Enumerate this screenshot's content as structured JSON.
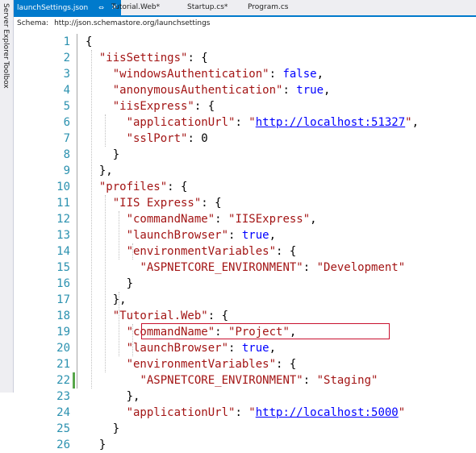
{
  "side_panel": {
    "server_explorer": "Server Explorer",
    "toolbox": "Toolbox"
  },
  "tabs": [
    {
      "label": "launchSettings.json",
      "active": true,
      "pinned": true
    },
    {
      "label": "Tutorial.Web*"
    },
    {
      "label": "Startup.cs*"
    },
    {
      "label": "Program.cs"
    }
  ],
  "schema_bar": {
    "label": "Schema:",
    "url": "http://json.schemastore.org/launchsettings"
  },
  "editor": {
    "lines": [
      {
        "n": "1",
        "tokens": [
          [
            "p",
            "{"
          ]
        ]
      },
      {
        "n": "2",
        "tokens": [
          [
            "s",
            "\"iisSettings\""
          ],
          [
            "p",
            ": {"
          ]
        ]
      },
      {
        "n": "3",
        "tokens": [
          [
            "s",
            "\"windowsAuthentication\""
          ],
          [
            "p",
            ": "
          ],
          [
            "n",
            "false"
          ],
          [
            "p",
            ","
          ]
        ]
      },
      {
        "n": "4",
        "tokens": [
          [
            "s",
            "\"anonymousAuthentication\""
          ],
          [
            "p",
            ": "
          ],
          [
            "n",
            "true"
          ],
          [
            "p",
            ","
          ]
        ]
      },
      {
        "n": "5",
        "tokens": [
          [
            "s",
            "\"iisExpress\""
          ],
          [
            "p",
            ": {"
          ]
        ]
      },
      {
        "n": "6",
        "tokens": [
          [
            "s",
            "\"applicationUrl\""
          ],
          [
            "p",
            ": "
          ],
          [
            "s",
            "\""
          ],
          [
            "u",
            "http://localhost:51327"
          ],
          [
            "s",
            "\""
          ],
          [
            "p",
            ","
          ]
        ]
      },
      {
        "n": "7",
        "tokens": [
          [
            "s",
            "\"sslPort\""
          ],
          [
            "p",
            ": 0"
          ]
        ]
      },
      {
        "n": "8",
        "tokens": [
          [
            "p",
            "}"
          ]
        ]
      },
      {
        "n": "9",
        "tokens": [
          [
            "p",
            "},"
          ]
        ]
      },
      {
        "n": "10",
        "tokens": [
          [
            "s",
            "\"profiles\""
          ],
          [
            "p",
            ": {"
          ]
        ]
      },
      {
        "n": "11",
        "tokens": [
          [
            "s",
            "\"IIS Express\""
          ],
          [
            "p",
            ": {"
          ]
        ]
      },
      {
        "n": "12",
        "tokens": [
          [
            "s",
            "\"commandName\""
          ],
          [
            "p",
            ": "
          ],
          [
            "s",
            "\"IISExpress\""
          ],
          [
            "p",
            ","
          ]
        ]
      },
      {
        "n": "13",
        "tokens": [
          [
            "s",
            "\"launchBrowser\""
          ],
          [
            "p",
            ": "
          ],
          [
            "n",
            "true"
          ],
          [
            "p",
            ","
          ]
        ]
      },
      {
        "n": "14",
        "tokens": [
          [
            "s",
            "\"environmentVariables\""
          ],
          [
            "p",
            ": {"
          ]
        ]
      },
      {
        "n": "15",
        "tokens": [
          [
            "s",
            "\"ASPNETCORE_ENVIRONMENT\""
          ],
          [
            "p",
            ": "
          ],
          [
            "s",
            "\"Development\""
          ]
        ]
      },
      {
        "n": "16",
        "tokens": [
          [
            "p",
            "}"
          ]
        ]
      },
      {
        "n": "17",
        "tokens": [
          [
            "p",
            "},"
          ]
        ]
      },
      {
        "n": "18",
        "tokens": [
          [
            "s",
            "\"Tutorial.Web\""
          ],
          [
            "p",
            ": {"
          ]
        ]
      },
      {
        "n": "19",
        "tokens": [
          [
            "s",
            "\"commandName\""
          ],
          [
            "p",
            ": "
          ],
          [
            "s",
            "\"Project\""
          ],
          [
            "p",
            ","
          ]
        ]
      },
      {
        "n": "20",
        "tokens": [
          [
            "s",
            "\"launchBrowser\""
          ],
          [
            "p",
            ": "
          ],
          [
            "n",
            "true"
          ],
          [
            "p",
            ","
          ]
        ]
      },
      {
        "n": "21",
        "tokens": [
          [
            "s",
            "\"environmentVariables\""
          ],
          [
            "p",
            ": {"
          ]
        ]
      },
      {
        "n": "22",
        "tokens": [
          [
            "s",
            "\"ASPNETCORE_ENVIRONMENT\""
          ],
          [
            "p",
            ": "
          ],
          [
            "s",
            "\"Staging\""
          ]
        ],
        "modified": true,
        "highlighted": true
      },
      {
        "n": "23",
        "tokens": [
          [
            "p",
            "},"
          ]
        ]
      },
      {
        "n": "24",
        "tokens": [
          [
            "s",
            "\"applicationUrl\""
          ],
          [
            "p",
            ": "
          ],
          [
            "s",
            "\""
          ],
          [
            "u",
            "http://localhost:5000"
          ],
          [
            "s",
            "\""
          ]
        ]
      },
      {
        "n": "25",
        "tokens": [
          [
            "p",
            "}"
          ]
        ]
      },
      {
        "n": "26",
        "tokens": [
          [
            "p",
            "}"
          ]
        ]
      }
    ]
  },
  "colors": {
    "accent": "#007acc",
    "string": "#a31515",
    "keyword": "#0000ff",
    "line_number": "#2b91af",
    "highlight_border": "#c8102e",
    "modified_marker": "#57a64a"
  }
}
